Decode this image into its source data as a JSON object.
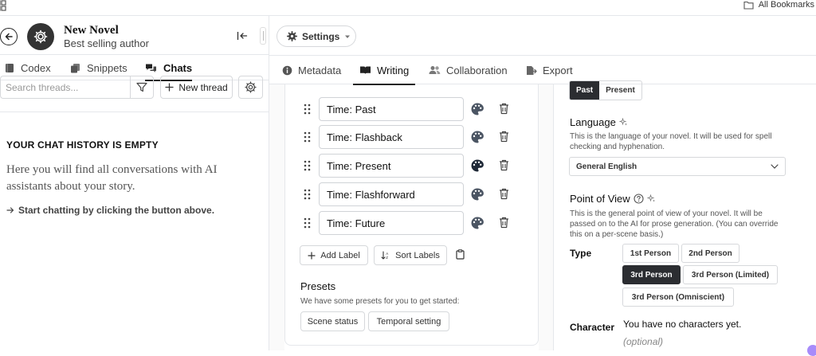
{
  "browser": {
    "bookmarks_label": "All Bookmarks",
    "grid_icon": "apps-grid-icon",
    "folder_icon": "folder-icon"
  },
  "project": {
    "title": "New Novel",
    "subtitle": "Best selling author",
    "back_icon": "arrow-left-circle-icon",
    "avatar_icon": "gear-icon",
    "collapse_icon": "collapse-left-icon"
  },
  "left_tabs": [
    {
      "label": "Codex",
      "icon": "book-icon"
    },
    {
      "label": "Snippets",
      "icon": "copy-icon"
    },
    {
      "label": "Chats",
      "icon": "chat-bubbles-icon",
      "active": true
    }
  ],
  "threads": {
    "search_placeholder": "Search threads...",
    "new_thread_label": "New thread",
    "empty_title": "YOUR CHAT HISTORY IS EMPTY",
    "empty_desc": "Here you will find all conversations with AI assistants about your story.",
    "empty_cta": "Start chatting by clicking the button above."
  },
  "settings_button": {
    "label": "Settings"
  },
  "main_tabs": [
    {
      "label": "Metadata",
      "icon": "info-icon"
    },
    {
      "label": "Writing",
      "icon": "open-book-icon",
      "active": true
    },
    {
      "label": "Collaboration",
      "icon": "users-icon"
    },
    {
      "label": "Export",
      "icon": "file-export-icon"
    }
  ],
  "labels": [
    {
      "text": "Time: Past",
      "color": "#4b5563"
    },
    {
      "text": "Time: Flashback",
      "color": "#4b5563"
    },
    {
      "text": "Time: Present",
      "color": "#1f2937"
    },
    {
      "text": "Time: Flashforward",
      "color": "#4b5563"
    },
    {
      "text": "Time: Future",
      "color": "#4b5563"
    }
  ],
  "label_actions": {
    "add_label": "Add Label",
    "sort_labels": "Sort Labels"
  },
  "presets": {
    "title": "Presets",
    "desc": "We have some presets for you to get started:",
    "items": [
      "Scene status",
      "Temporal setting"
    ]
  },
  "tense": {
    "options": [
      "Past",
      "Present"
    ],
    "selected": "Past"
  },
  "language": {
    "heading": "Language",
    "desc": "This is the language of your novel. It will be used for spell checking and hyphenation.",
    "selected": "General English"
  },
  "pov": {
    "heading": "Point of View",
    "desc": "This is the general point of view of your novel. It will be passed on to the AI for prose generation. (You can override this on a per-scene basis.)",
    "type_label": "Type",
    "options": [
      "1st Person",
      "2nd Person",
      "3rd Person",
      "3rd Person (Limited)",
      "3rd Person (Omniscient)"
    ],
    "selected": "3rd Person",
    "character_label": "Character",
    "character_empty": "You have no characters yet.",
    "character_optional": "(optional)"
  },
  "colors": {
    "accent_dark": "#2b2d31",
    "border": "#d6d8db",
    "muted_text": "#555555"
  }
}
